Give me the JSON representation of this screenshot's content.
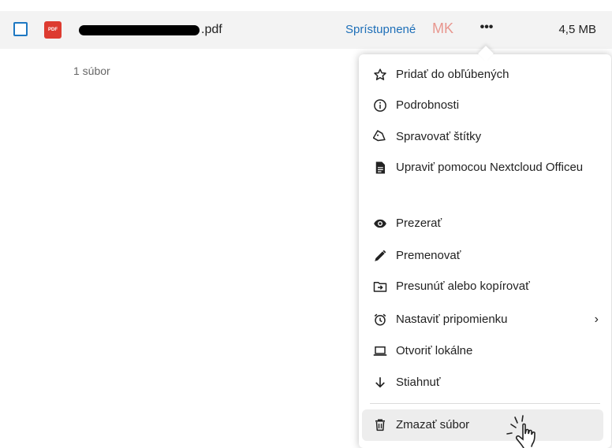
{
  "file_row": {
    "file_extension": ".pdf",
    "pdf_badge": "PDF",
    "share_status": "Sprístupnené",
    "owner_initials": "MK",
    "more_label": "•••",
    "file_size": "4,5 MB"
  },
  "summary": {
    "file_count": "1 súbor"
  },
  "menu": {
    "items": [
      {
        "label": "Pridať do obľúbených",
        "icon": "star-icon"
      },
      {
        "label": "Podrobnosti",
        "icon": "info-icon"
      },
      {
        "label": "Spravovať štítky",
        "icon": "tag-icon"
      },
      {
        "label": "Upraviť pomocou Nextcloud Officeu",
        "icon": "document-icon"
      },
      {
        "label": "Prezerať",
        "icon": "eye-icon"
      },
      {
        "label": "Premenovať",
        "icon": "pencil-icon"
      },
      {
        "label": "Presunúť alebo kopírovať",
        "icon": "folder-move-icon"
      },
      {
        "label": "Nastaviť pripomienku",
        "icon": "alarm-clock-icon",
        "submenu_arrow": "›"
      },
      {
        "label": "Otvoriť lokálne",
        "icon": "laptop-icon"
      },
      {
        "label": "Stiahnuť",
        "icon": "download-arrow-icon"
      },
      {
        "label": "Zmazať súbor",
        "icon": "trash-icon"
      }
    ]
  },
  "colors": {
    "link_blue": "#1e6fb8",
    "pdf_red": "#dd3b30",
    "initials_pink": "#e8968e",
    "row_background": "#f3f3f3",
    "hover_background": "#ededed"
  }
}
